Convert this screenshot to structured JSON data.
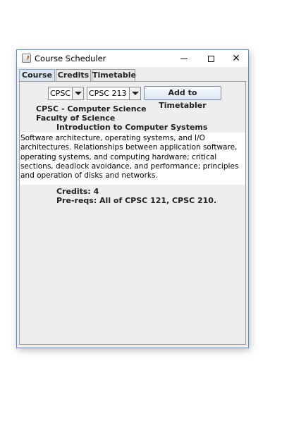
{
  "window": {
    "title": "Course Scheduler",
    "icon": "java-cup-icon",
    "controls": [
      "minimize",
      "maximize",
      "close"
    ]
  },
  "tabs": [
    {
      "label": "Course",
      "active": true
    },
    {
      "label": "Credits",
      "active": false
    },
    {
      "label": "Timetable",
      "active": false
    }
  ],
  "course_panel": {
    "department_select": {
      "value": "CPSC"
    },
    "course_select": {
      "value": "CPSC 213"
    },
    "add_button_label": "Add to Timetabler",
    "department_name": "CPSC - Computer Science",
    "faculty": "Faculty of Science",
    "course_title": "Introduction to Computer Systems",
    "description": "Software architecture, operating systems, and I/O architectures. Relationships between application software, operating systems, and computing hardware; critical sections, deadlock avoidance, and performance; principles and operation of disks and networks.",
    "credits": "Credits: 4",
    "prereqs": "Pre-reqs: All of CPSC 121, CPSC 210."
  },
  "colors": {
    "window_border": "#5b8fd1",
    "active_tab": "#dbe6f4",
    "panel_bg": "#eeeeee"
  }
}
